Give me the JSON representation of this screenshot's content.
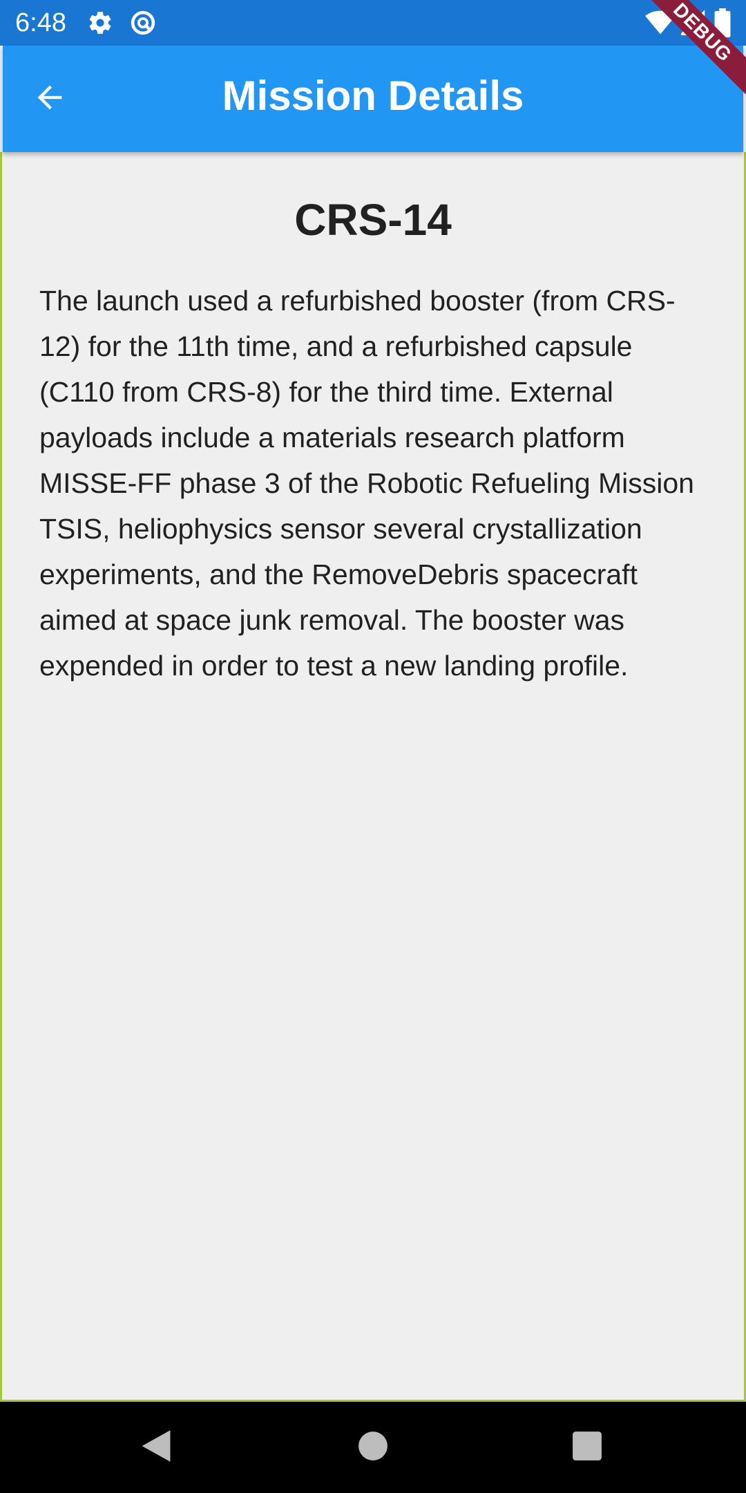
{
  "status_bar": {
    "time": "6:48",
    "icons": [
      "settings-icon",
      "sync-icon",
      "wifi-icon",
      "signal-icon",
      "battery-icon"
    ]
  },
  "app_bar": {
    "title": "Mission Details",
    "back_icon": "arrow-back-icon",
    "color": "#2196f3"
  },
  "debug_banner": {
    "label": "DEBUG",
    "color": "#8b1c3c"
  },
  "mission": {
    "name": "CRS-14",
    "description": "The launch used a refurbished booster (from CRS-12) for the 11th time, and a refurbished capsule (C110 from CRS-8) for the third time. External payloads include a materials research platform MISSE-FF phase 3 of the Robotic Refueling Mission TSIS, heliophysics sensor several crystallization experiments, and the RemoveDebris spacecraft aimed at space junk removal. The booster was expended in order to test a new landing profile."
  },
  "nav_bar": {
    "buttons": [
      "back-triangle-icon",
      "home-circle-icon",
      "recents-square-icon"
    ]
  }
}
